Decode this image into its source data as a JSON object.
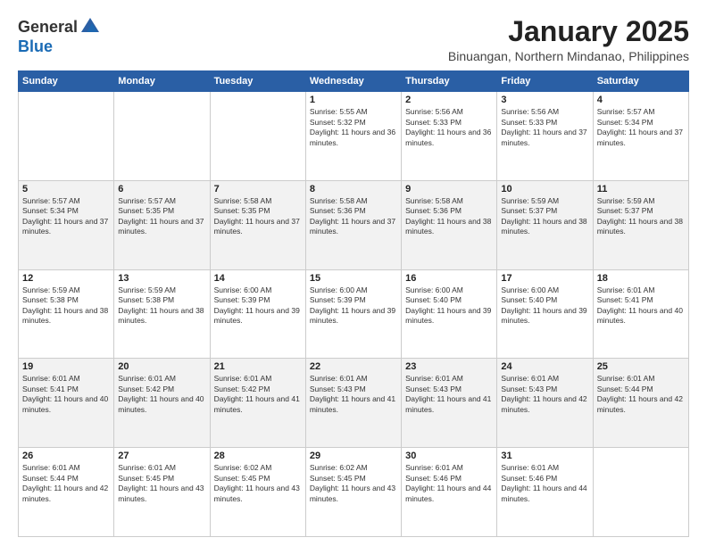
{
  "header": {
    "logo_general": "General",
    "logo_blue": "Blue",
    "month": "January 2025",
    "location": "Binuangan, Northern Mindanao, Philippines"
  },
  "weekdays": [
    "Sunday",
    "Monday",
    "Tuesday",
    "Wednesday",
    "Thursday",
    "Friday",
    "Saturday"
  ],
  "weeks": [
    [
      {
        "day": "",
        "sunrise": "",
        "sunset": "",
        "daylight": ""
      },
      {
        "day": "",
        "sunrise": "",
        "sunset": "",
        "daylight": ""
      },
      {
        "day": "",
        "sunrise": "",
        "sunset": "",
        "daylight": ""
      },
      {
        "day": "1",
        "sunrise": "5:55 AM",
        "sunset": "5:32 PM",
        "daylight": "11 hours and 36 minutes."
      },
      {
        "day": "2",
        "sunrise": "5:56 AM",
        "sunset": "5:33 PM",
        "daylight": "11 hours and 36 minutes."
      },
      {
        "day": "3",
        "sunrise": "5:56 AM",
        "sunset": "5:33 PM",
        "daylight": "11 hours and 37 minutes."
      },
      {
        "day": "4",
        "sunrise": "5:57 AM",
        "sunset": "5:34 PM",
        "daylight": "11 hours and 37 minutes."
      }
    ],
    [
      {
        "day": "5",
        "sunrise": "5:57 AM",
        "sunset": "5:34 PM",
        "daylight": "11 hours and 37 minutes."
      },
      {
        "day": "6",
        "sunrise": "5:57 AM",
        "sunset": "5:35 PM",
        "daylight": "11 hours and 37 minutes."
      },
      {
        "day": "7",
        "sunrise": "5:58 AM",
        "sunset": "5:35 PM",
        "daylight": "11 hours and 37 minutes."
      },
      {
        "day": "8",
        "sunrise": "5:58 AM",
        "sunset": "5:36 PM",
        "daylight": "11 hours and 37 minutes."
      },
      {
        "day": "9",
        "sunrise": "5:58 AM",
        "sunset": "5:36 PM",
        "daylight": "11 hours and 38 minutes."
      },
      {
        "day": "10",
        "sunrise": "5:59 AM",
        "sunset": "5:37 PM",
        "daylight": "11 hours and 38 minutes."
      },
      {
        "day": "11",
        "sunrise": "5:59 AM",
        "sunset": "5:37 PM",
        "daylight": "11 hours and 38 minutes."
      }
    ],
    [
      {
        "day": "12",
        "sunrise": "5:59 AM",
        "sunset": "5:38 PM",
        "daylight": "11 hours and 38 minutes."
      },
      {
        "day": "13",
        "sunrise": "5:59 AM",
        "sunset": "5:38 PM",
        "daylight": "11 hours and 38 minutes."
      },
      {
        "day": "14",
        "sunrise": "6:00 AM",
        "sunset": "5:39 PM",
        "daylight": "11 hours and 39 minutes."
      },
      {
        "day": "15",
        "sunrise": "6:00 AM",
        "sunset": "5:39 PM",
        "daylight": "11 hours and 39 minutes."
      },
      {
        "day": "16",
        "sunrise": "6:00 AM",
        "sunset": "5:40 PM",
        "daylight": "11 hours and 39 minutes."
      },
      {
        "day": "17",
        "sunrise": "6:00 AM",
        "sunset": "5:40 PM",
        "daylight": "11 hours and 39 minutes."
      },
      {
        "day": "18",
        "sunrise": "6:01 AM",
        "sunset": "5:41 PM",
        "daylight": "11 hours and 40 minutes."
      }
    ],
    [
      {
        "day": "19",
        "sunrise": "6:01 AM",
        "sunset": "5:41 PM",
        "daylight": "11 hours and 40 minutes."
      },
      {
        "day": "20",
        "sunrise": "6:01 AM",
        "sunset": "5:42 PM",
        "daylight": "11 hours and 40 minutes."
      },
      {
        "day": "21",
        "sunrise": "6:01 AM",
        "sunset": "5:42 PM",
        "daylight": "11 hours and 41 minutes."
      },
      {
        "day": "22",
        "sunrise": "6:01 AM",
        "sunset": "5:43 PM",
        "daylight": "11 hours and 41 minutes."
      },
      {
        "day": "23",
        "sunrise": "6:01 AM",
        "sunset": "5:43 PM",
        "daylight": "11 hours and 41 minutes."
      },
      {
        "day": "24",
        "sunrise": "6:01 AM",
        "sunset": "5:43 PM",
        "daylight": "11 hours and 42 minutes."
      },
      {
        "day": "25",
        "sunrise": "6:01 AM",
        "sunset": "5:44 PM",
        "daylight": "11 hours and 42 minutes."
      }
    ],
    [
      {
        "day": "26",
        "sunrise": "6:01 AM",
        "sunset": "5:44 PM",
        "daylight": "11 hours and 42 minutes."
      },
      {
        "day": "27",
        "sunrise": "6:01 AM",
        "sunset": "5:45 PM",
        "daylight": "11 hours and 43 minutes."
      },
      {
        "day": "28",
        "sunrise": "6:02 AM",
        "sunset": "5:45 PM",
        "daylight": "11 hours and 43 minutes."
      },
      {
        "day": "29",
        "sunrise": "6:02 AM",
        "sunset": "5:45 PM",
        "daylight": "11 hours and 43 minutes."
      },
      {
        "day": "30",
        "sunrise": "6:01 AM",
        "sunset": "5:46 PM",
        "daylight": "11 hours and 44 minutes."
      },
      {
        "day": "31",
        "sunrise": "6:01 AM",
        "sunset": "5:46 PM",
        "daylight": "11 hours and 44 minutes."
      },
      {
        "day": "",
        "sunrise": "",
        "sunset": "",
        "daylight": ""
      }
    ]
  ]
}
